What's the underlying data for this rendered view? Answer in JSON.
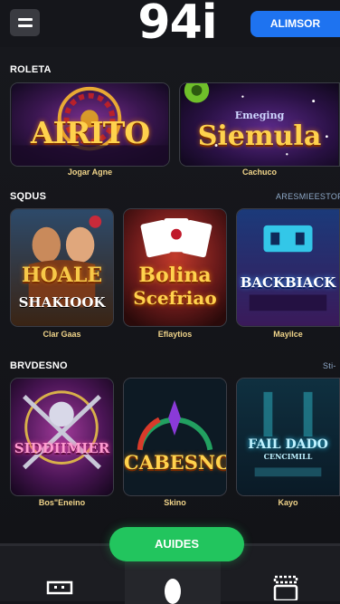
{
  "header": {
    "logo": "94i",
    "action_label": "ALIMSOR"
  },
  "sections": [
    {
      "title": "ROLETA",
      "link": "",
      "items": [
        {
          "art": "AIRITO",
          "caption": "Jogar Agne"
        },
        {
          "art_small": "Emeging",
          "art": "Siemula",
          "caption": "Cachuco"
        }
      ]
    },
    {
      "title": "SQDUS",
      "link": "ARESMIEESTOP",
      "items": [
        {
          "art": "HOALE",
          "art2": "SHAKIOOK",
          "caption": "Clar Gaas"
        },
        {
          "art": "Bolina",
          "art2": "Scefriao",
          "caption": "Eflaytios"
        },
        {
          "art": "BACKBIACK",
          "caption": "Mayilce"
        }
      ]
    },
    {
      "title": "BRVDESNO",
      "link": "Sti-",
      "items": [
        {
          "art": "SIDDIIMIER",
          "caption": "Bos\"Eneino"
        },
        {
          "art": "CABESNO",
          "caption": "Skino"
        },
        {
          "art": "FAIL DADO",
          "art2": "CENCIMILL",
          "caption": "Kayo"
        }
      ]
    }
  ],
  "cta": {
    "label": "AUIDES"
  },
  "nav": [
    {
      "icon": "cashier-icon"
    },
    {
      "icon": "spin-icon"
    },
    {
      "icon": "games-icon"
    }
  ],
  "colors": {
    "accent_blue": "#1e73f0",
    "accent_green": "#22c55e",
    "background": "#15161b"
  }
}
